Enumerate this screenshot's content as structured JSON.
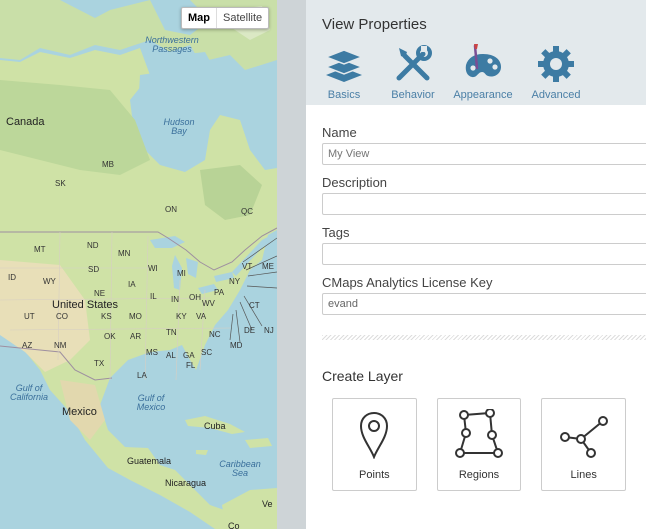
{
  "map": {
    "toggle": {
      "map_label": "Map",
      "satellite_label": "Satellite",
      "active": "Map"
    },
    "labels": {
      "northwest_passages": "Northwestern Passages",
      "hudson_bay": "Hudson Bay",
      "canada": "Canada",
      "united_states": "United States",
      "mexico": "Mexico",
      "gulf_of_california": "Gulf of California",
      "gulf_of_mexico": "Gulf of Mexico",
      "caribbean_sea": "Caribbean Sea",
      "cuba": "Cuba",
      "guatemala": "Guatemala",
      "nicaragua": "Nicaragua",
      "venezuela_fragment": "Ve",
      "columbia_fragment": "Co",
      "states": {
        "mb": "MB",
        "sk": "SK",
        "on": "ON",
        "qc": "QC",
        "mt": "MT",
        "nd": "ND",
        "mn": "MN",
        "id": "ID",
        "wy": "WY",
        "sd": "SD",
        "wi": "WI",
        "mi": "MI",
        "ne": "NE",
        "ia": "IA",
        "il": "IL",
        "in": "IN",
        "oh": "OH",
        "pa": "PA",
        "ny": "NY",
        "vt": "VT",
        "me": "ME",
        "ct": "CT",
        "nj": "NJ",
        "de": "DE",
        "md": "MD",
        "va": "VA",
        "wv": "WV",
        "ut": "UT",
        "co": "CO",
        "ks": "KS",
        "mo": "MO",
        "ky": "KY",
        "tn": "TN",
        "nc": "NC",
        "sc": "SC",
        "az": "AZ",
        "nm": "NM",
        "ok": "OK",
        "ar": "AR",
        "ms": "MS",
        "al": "AL",
        "ga": "GA",
        "tx": "TX",
        "la": "LA",
        "fl": "FL"
      }
    }
  },
  "panel": {
    "title": "View Properties",
    "tabs": [
      {
        "label": "Basics",
        "icon": "layers-icon"
      },
      {
        "label": "Behavior",
        "icon": "tools-icon"
      },
      {
        "label": "Appearance",
        "icon": "palette-icon"
      },
      {
        "label": "Advanced",
        "icon": "gear-icon"
      }
    ],
    "fields": {
      "name": {
        "label": "Name",
        "placeholder": "My View",
        "value": ""
      },
      "description": {
        "label": "Description",
        "value": ""
      },
      "tags": {
        "label": "Tags",
        "value": ""
      },
      "license": {
        "label": "CMaps Analytics License Key",
        "value": "evand"
      }
    },
    "create_layer": {
      "title": "Create Layer",
      "cards": [
        {
          "label": "Points",
          "icon": "map-pin-icon"
        },
        {
          "label": "Regions",
          "icon": "polygon-icon"
        },
        {
          "label": "Lines",
          "icon": "network-lines-icon"
        }
      ]
    },
    "colors": {
      "header_bg": "#e3e9ec",
      "tab_icon": "#3d7ba3",
      "tab_label": "#4a7fa6",
      "divider": "#ced4d7"
    }
  }
}
